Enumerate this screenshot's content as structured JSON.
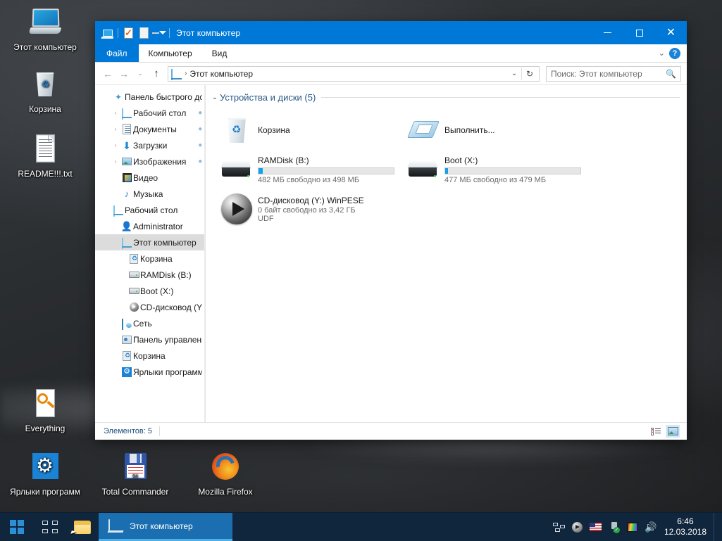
{
  "desktop": {
    "icons": [
      {
        "label": "Этот компьютер",
        "icon": "computer-icon"
      },
      {
        "label": "Корзина",
        "icon": "recycle-bin-icon"
      },
      {
        "label": "README!!!.txt",
        "icon": "text-document-icon"
      },
      {
        "label": "Everything",
        "icon": "everything-search-icon"
      },
      {
        "label": "Ярлыки программ",
        "icon": "gear-icon"
      },
      {
        "label": "Total Commander",
        "icon": "floppy-disk-icon"
      },
      {
        "label": "Mozilla Firefox",
        "icon": "firefox-icon"
      }
    ]
  },
  "window": {
    "title": "Этот компьютер",
    "quick_access": [
      {
        "name": "computer-icon"
      },
      {
        "name": "properties-icon"
      },
      {
        "name": "new-folder-icon"
      },
      {
        "name": "customize-dropdown-icon"
      }
    ],
    "buttons": {
      "minimize": "—",
      "maximize": "□",
      "close": "✕"
    },
    "ribbon_tabs": [
      {
        "label": "Файл",
        "active": true
      },
      {
        "label": "Компьютер",
        "active": false
      },
      {
        "label": "Вид",
        "active": false
      }
    ],
    "ribbon_right": {
      "expand": "⌄",
      "help": "?"
    },
    "nav": {
      "back": "←",
      "forward": "→",
      "recent": "⌄",
      "up": "↑",
      "address_icon": "computer-icon",
      "address_sep": "›",
      "address_text": "Этот компьютер",
      "address_dropdown": "⌄",
      "refresh": "↻"
    },
    "search": {
      "placeholder": "Поиск: Этот компьютер",
      "icon": "search-icon"
    },
    "tree": [
      {
        "label": "Панель быстрого дс",
        "icon": "quick-access-star-icon",
        "indent": 0,
        "twisty": "",
        "pin": "",
        "selected": false
      },
      {
        "label": "Рабочий стол",
        "icon": "desktop-monitor-icon",
        "indent": 1,
        "twisty": "›",
        "pin": "📌",
        "selected": false
      },
      {
        "label": "Документы",
        "icon": "documents-icon",
        "indent": 1,
        "twisty": "›",
        "pin": "📌",
        "selected": false
      },
      {
        "label": "Загрузки",
        "icon": "downloads-icon",
        "indent": 1,
        "twisty": "›",
        "pin": "📌",
        "selected": false
      },
      {
        "label": "Изображения",
        "icon": "pictures-icon",
        "indent": 1,
        "twisty": "›",
        "pin": "📌",
        "selected": false
      },
      {
        "label": "Видео",
        "icon": "videos-icon",
        "indent": 1,
        "twisty": "",
        "pin": "",
        "selected": false
      },
      {
        "label": "Музыка",
        "icon": "music-icon",
        "indent": 1,
        "twisty": "",
        "pin": "",
        "selected": false
      },
      {
        "label": "Рабочий стол",
        "icon": "desktop-monitor-icon",
        "indent": 0,
        "twisty": "",
        "pin": "",
        "selected": false
      },
      {
        "label": "Administrator",
        "icon": "user-icon",
        "indent": 1,
        "twisty": "",
        "pin": "",
        "selected": false
      },
      {
        "label": "Этот компьютер",
        "icon": "computer-icon",
        "indent": 1,
        "twisty": "",
        "pin": "",
        "selected": true
      },
      {
        "label": "Корзина",
        "icon": "recycle-bin-icon",
        "indent": 2,
        "twisty": "",
        "pin": "",
        "selected": false
      },
      {
        "label": "RAMDisk (B:)",
        "icon": "hard-drive-icon",
        "indent": 2,
        "twisty": "",
        "pin": "",
        "selected": false
      },
      {
        "label": "Boot (X:)",
        "icon": "hard-drive-icon",
        "indent": 2,
        "twisty": "",
        "pin": "",
        "selected": false
      },
      {
        "label": "CD-дисковод (Y:)",
        "icon": "cd-drive-icon",
        "indent": 2,
        "twisty": "",
        "pin": "",
        "selected": false
      },
      {
        "label": "Сеть",
        "icon": "network-icon",
        "indent": 1,
        "twisty": "",
        "pin": "",
        "selected": false
      },
      {
        "label": "Панель управлени",
        "icon": "control-panel-icon",
        "indent": 1,
        "twisty": "",
        "pin": "",
        "selected": false
      },
      {
        "label": "Корзина",
        "icon": "recycle-bin-icon",
        "indent": 1,
        "twisty": "",
        "pin": "",
        "selected": false
      },
      {
        "label": "Ярлыки программ",
        "icon": "gear-icon",
        "indent": 1,
        "twisty": "",
        "pin": "",
        "selected": false
      }
    ],
    "group": {
      "chevron": "⌄",
      "title": "Устройства и диски (5)"
    },
    "items": [
      {
        "name": "Корзина",
        "icon": "recycle-bin-icon",
        "sub": "",
        "sub2": "",
        "has_bar": false,
        "bar_percent": 0
      },
      {
        "name": "Выполнить...",
        "icon": "run-dialog-icon",
        "sub": "",
        "sub2": "",
        "has_bar": false,
        "bar_percent": 0
      },
      {
        "name": "RAMDisk (B:)",
        "icon": "hard-drive-icon",
        "sub": "482 МБ свободно из 498 МБ",
        "sub2": "",
        "has_bar": true,
        "bar_percent": 3
      },
      {
        "name": "Boot (X:)",
        "icon": "hard-drive-icon",
        "sub": "477 МБ свободно из 479 МБ",
        "sub2": "",
        "has_bar": true,
        "bar_percent": 2
      },
      {
        "name": "CD-дисковод (Y:) WinPESE",
        "icon": "cd-drive-icon",
        "sub": "0 байт свободно из 3,42 ГБ",
        "sub2": "UDF",
        "has_bar": false,
        "bar_percent": 100
      }
    ],
    "status": {
      "text": "Элементов: 5",
      "views": [
        {
          "name": "details-view-button",
          "active": false
        },
        {
          "name": "large-icons-view-button",
          "active": true
        }
      ]
    }
  },
  "taskbar": {
    "start": "start-button",
    "task_view": "task-view-button",
    "file_explorer": "file-explorer-button",
    "active_task": "Этот компьютер",
    "tray": [
      {
        "name": "network-tray-icon"
      },
      {
        "name": "media-player-tray-icon"
      },
      {
        "name": "language-flag-tray-icon"
      },
      {
        "name": "safely-remove-usb-tray-icon"
      },
      {
        "name": "color-profile-tray-icon"
      },
      {
        "name": "volume-tray-icon"
      }
    ],
    "clock": {
      "time": "6:46",
      "date": "12.03.2018"
    }
  },
  "colors": {
    "accent": "#0078d7",
    "titlebar": "#0078d7",
    "taskbar": "#10263c",
    "progress": "#16a0e8",
    "selection": "#dcdcdc",
    "group_title": "#2b5a86"
  }
}
